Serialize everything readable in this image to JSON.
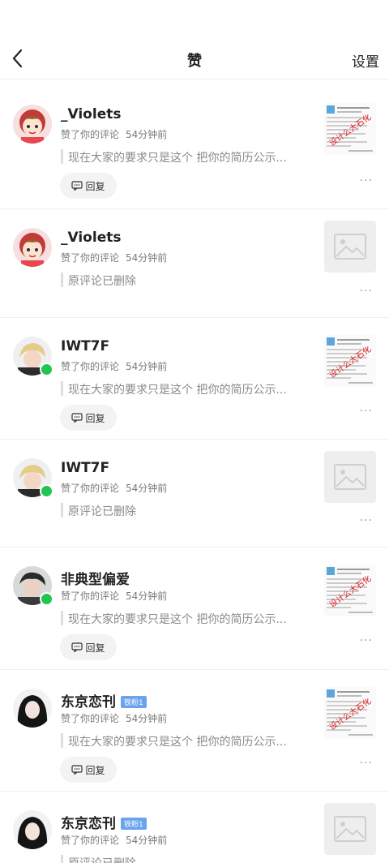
{
  "header": {
    "title": "赞",
    "settings_label": "设置"
  },
  "items": [
    {
      "name": "_Violets",
      "action": "赞了你的评论",
      "time": "54分钟前",
      "comment": "现在大家的要求只是这个 把你的简历公示...",
      "reply_label": "回复"
    },
    {
      "name": "_Violets",
      "action": "赞了你的评论",
      "time": "54分钟前",
      "comment": "原评论已删除"
    },
    {
      "name": "IWT7F",
      "action": "赞了你的评论",
      "time": "54分钟前",
      "comment": "现在大家的要求只是这个 把你的简历公示...",
      "reply_label": "回复"
    },
    {
      "name": "IWT7F",
      "action": "赞了你的评论",
      "time": "54分钟前",
      "comment": "原评论已删除"
    },
    {
      "name": "非典型偏爱",
      "action": "赞了你的评论",
      "time": "54分钟前",
      "comment": "现在大家的要求只是这个 把你的简历公示...",
      "reply_label": "回复"
    },
    {
      "name": "东京恋刊",
      "badge": "铁粉1",
      "action": "赞了你的评论",
      "time": "54分钟前",
      "comment": "现在大家的要求只是这个 把你的简历公示...",
      "reply_label": "回复"
    },
    {
      "name": "东京恋刊",
      "badge": "铁粉1",
      "action": "赞了你的评论",
      "time": "54分钟前",
      "comment": "原评论已删除"
    }
  ],
  "thumb_stamp_text": "设计么大石化",
  "more_glyph": "···",
  "icons": {
    "back": "chevron-left-icon",
    "reply": "comment-icon",
    "placeholder": "image-placeholder-icon"
  },
  "colors": {
    "online": "#22c454",
    "badge": "#6aa4ee",
    "stamp": "#e02020"
  }
}
